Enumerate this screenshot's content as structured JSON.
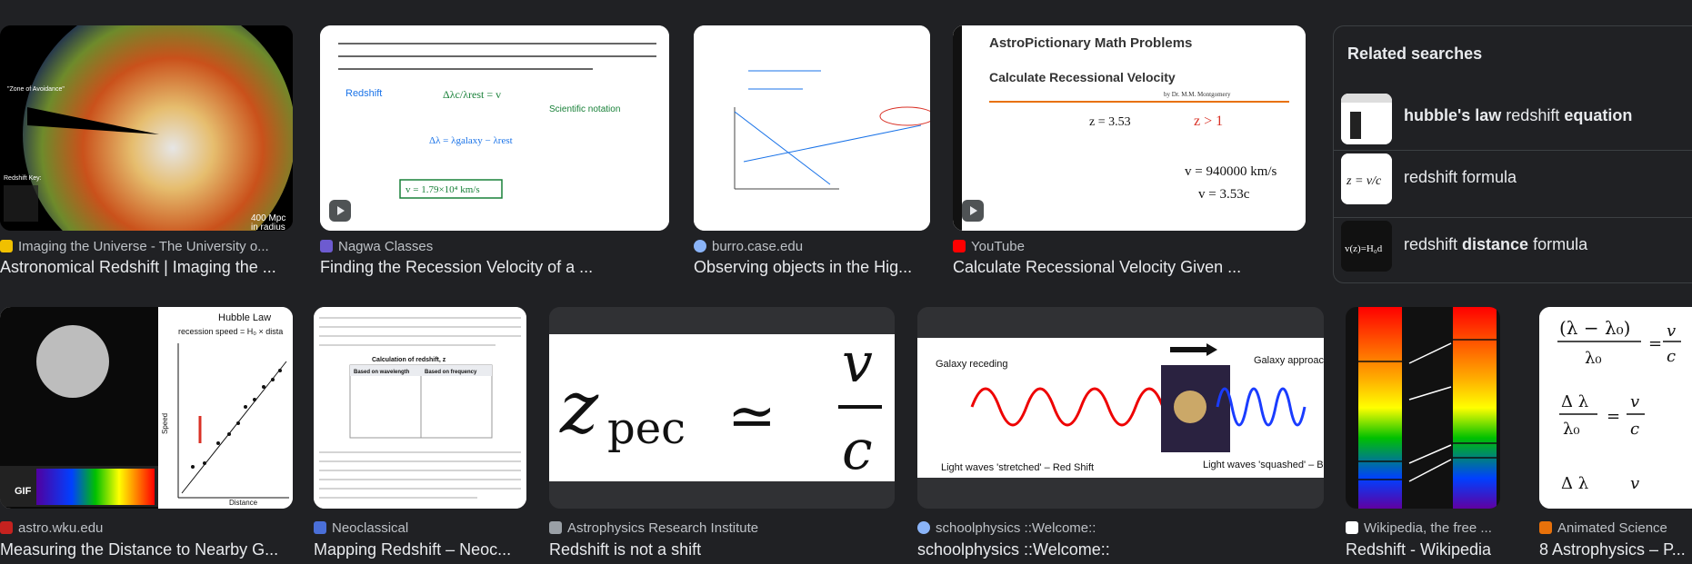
{
  "top_row": [
    {
      "source": "Imaging the Universe - The University o...",
      "title": "Astronomical Redshift | Imaging the ...",
      "favicon_color": "#f0c000"
    },
    {
      "source": "Nagwa Classes",
      "title": "Finding the Recession Velocity of a ...",
      "favicon_color": "#6d5bd0"
    },
    {
      "source": "burro.case.edu",
      "title": "Observing objects in the Hig...",
      "favicon_color": "#8ab4f8"
    },
    {
      "source": "YouTube",
      "title": "Calculate Recessional Velocity Given ...",
      "favicon_color": "#ff0000"
    }
  ],
  "bottom_row": [
    {
      "source": "astro.wku.edu",
      "title": "Measuring the Distance to Nearby G...",
      "favicon_color": "#c5221f"
    },
    {
      "source": "Neoclassical",
      "title": "Mapping Redshift – Neoc...",
      "favicon_color": "#4a6fd8"
    },
    {
      "source": "Astrophysics Research Institute",
      "title": "Redshift is not a shift",
      "favicon_color": "#9aa0a6"
    },
    {
      "source": "schoolphysics ::Welcome::",
      "title": "schoolphysics ::Welcome::",
      "favicon_color": "#8ab4f8"
    },
    {
      "source": "Wikipedia, the free ...",
      "title": "Redshift - Wikipedia",
      "favicon_color": "#ffffff"
    },
    {
      "source": "Animated Science",
      "title": "8 Astrophysics – P...",
      "favicon_color": "#e8710a"
    }
  ],
  "related": {
    "heading": "Related searches",
    "items": [
      {
        "bold1": "hubble's law",
        "plain": " redshift ",
        "bold2": "equation"
      },
      {
        "bold1": "",
        "plain": "redshift formula",
        "bold2": ""
      },
      {
        "bold1": "",
        "plain": "redshift ",
        "bold2": "distance",
        "plain2": " formula"
      }
    ]
  },
  "thumb_text": {
    "t1_zone": "\"Zone of Avoidance\"",
    "t1_key": "Redshift Key:",
    "t1_scale": "400 Mpc",
    "t1_scale2": "in radius",
    "t2_redshift": "Redshift",
    "t2_sci": "Scientific notation",
    "t4_brand": "AstroPictionary Math Problems",
    "t4_heading": "Calculate Recessional Velocity",
    "t4_author": "by Dr. M.M. Montgomery",
    "b1_title": "Hubble Law",
    "b1_sub": "recession speed = H₀ × dista",
    "b1_speed": "Speed",
    "b1_distance": "Distance",
    "b1_gif": "GIF",
    "b2_calc": "Calculation of redshift, z",
    "b2_wave": "Based on wavelength",
    "b2_freq": "Based on frequency",
    "b3_z": "z",
    "b3_pec": "pec",
    "b3_approx": "≃",
    "b3_v": "v",
    "b3_c": "c",
    "b4_recede": "Galaxy receding",
    "b4_approach": "Galaxy approac",
    "b4_stretched": "Light waves 'stretched' – Red Shift",
    "b4_squashed": "Light waves 'squashed' – B"
  }
}
